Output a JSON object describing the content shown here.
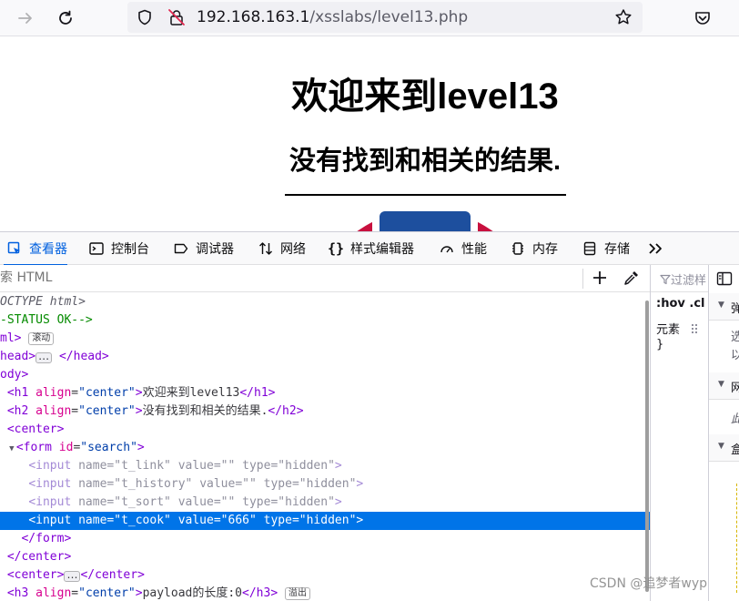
{
  "browser": {
    "url_host": "192.168.163.1",
    "url_path": "/xsslabs/level13.php"
  },
  "page": {
    "h1": "欢迎来到level13",
    "h2": "没有找到和相关的结果."
  },
  "devtools": {
    "tabs": [
      {
        "label": "查看器",
        "icon": "inspector-icon",
        "active": true
      },
      {
        "label": "控制台",
        "icon": "console-icon"
      },
      {
        "label": "调试器",
        "icon": "debugger-icon"
      },
      {
        "label": "网络",
        "icon": "network-icon"
      },
      {
        "label": "样式编辑器",
        "icon": "style-editor-icon"
      },
      {
        "label": "性能",
        "icon": "performance-icon"
      },
      {
        "label": "内存",
        "icon": "memory-icon"
      },
      {
        "label": "存储",
        "icon": "storage-icon"
      }
    ],
    "search_placeholder": "索 HTML",
    "rules": {
      "filter": "过滤样",
      "hov": ":hov",
      "cls": ".cl",
      "element": "元素",
      "brace": "}"
    },
    "layout": {
      "s1": "弹",
      "s2a": "选",
      "s2b": "以",
      "s3": "网",
      "s4": "此",
      "s5": "盒"
    },
    "markup": {
      "doctype": "OCTYPE html>",
      "comment": "-STATUS OK-->",
      "html_tag": "ml>",
      "scroll_badge": "滚动",
      "head_open": "head>",
      "head_close": "</head>",
      "body_open": "ody>",
      "h1_text": "欢迎来到level13",
      "h2_text": "没有找到和相关的结果.",
      "h3_text": "payload的长度:0",
      "overflow_badge": "溢出",
      "form_id": "search",
      "inputs": [
        {
          "name": "t_link",
          "value": ""
        },
        {
          "name": "t_history",
          "value": ""
        },
        {
          "name": "t_sort",
          "value": ""
        },
        {
          "name": "t_cook",
          "value": "666"
        }
      ],
      "align_center": "center",
      "type_hidden": "hidden"
    }
  },
  "watermark": "CSDN @追梦者wyp"
}
